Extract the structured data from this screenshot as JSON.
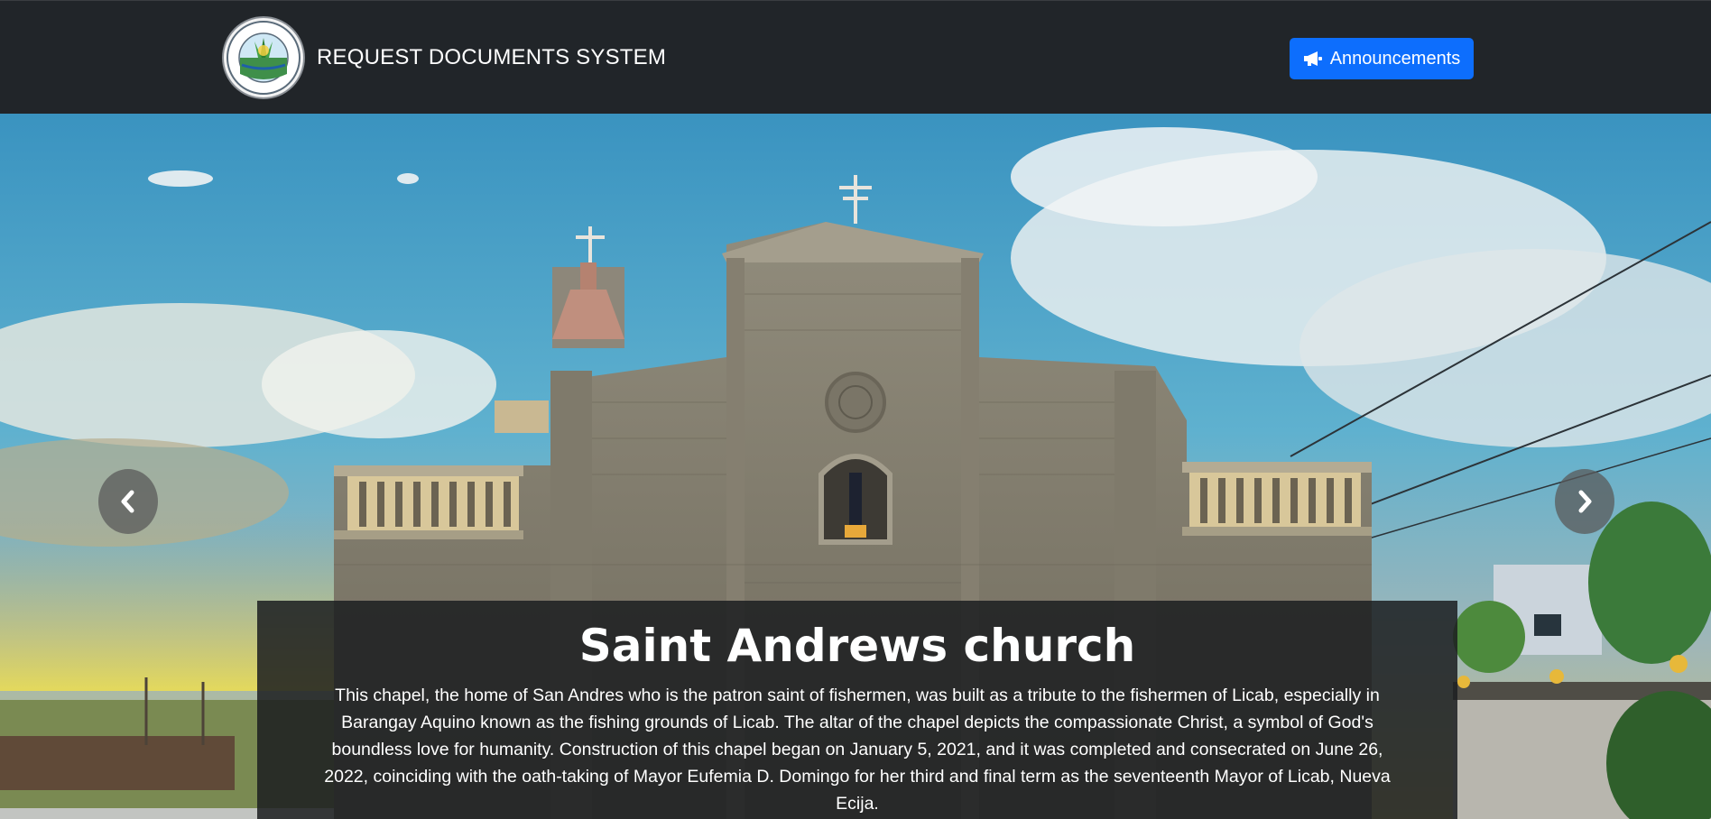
{
  "navbar": {
    "brand_title": "REQUEST DOCUMENTS SYSTEM",
    "logo_alt": "Barangay Aquino, Licab, Nueva Ecija seal",
    "logo_text_top": "BARANGAY AQUINO",
    "logo_text_bottom": "LICAB, NUEVA ECIJA",
    "announcements_label": "Announcements",
    "announcements_icon": "megaphone-icon"
  },
  "carousel": {
    "slide_image": "church-facade-photo",
    "prev_icon": "chevron-left-icon",
    "next_icon": "chevron-right-icon",
    "caption_title": "Saint Andrews church",
    "caption_text": "This chapel, the home of San Andres who is the patron saint of fishermen, was built as a tribute to the fishermen of Licab, especially in Barangay Aquino known as the fishing grounds of Licab. The altar of the chapel depicts the compassionate Christ, a symbol of God's boundless love for humanity. Construction of this chapel began on January 5, 2021, and it was completed and consecrated on June 26, 2022, coinciding with the oath-taking of Mayor Eufemia D. Domingo for her third and final term as the seventeenth Mayor of Licab, Nueva Ecija."
  },
  "colors": {
    "navbar_bg": "#212529",
    "primary": "#0d6efd",
    "sky": "#3d9ec6",
    "stone": "#8a8576"
  }
}
